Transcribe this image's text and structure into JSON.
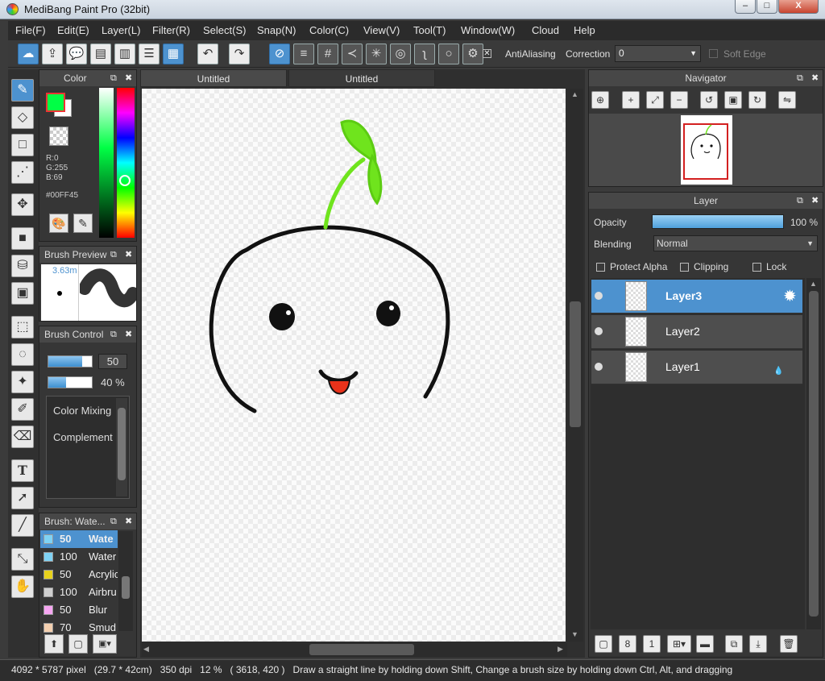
{
  "window": {
    "title": "MediBang Paint Pro (32bit)",
    "minimize": "–",
    "maximize": "□",
    "close": "X"
  },
  "menu": [
    "File(F)",
    "Edit(E)",
    "Layer(L)",
    "Filter(R)",
    "Select(S)",
    "Snap(N)",
    "Color(C)",
    "View(V)",
    "Tool(T)",
    "Window(W)",
    "Cloud",
    "Help"
  ],
  "toolbar": {
    "antialiasing_label": "AntiAliasing",
    "correction_label": "Correction",
    "correction_value": "0",
    "soft_edge_label": "Soft Edge",
    "antialiasing_checked": "✕"
  },
  "color_panel": {
    "title": "Color",
    "r": "R:0",
    "g": "G:255",
    "b": "B:69",
    "hex": "#00FF45",
    "fg": "#00ff45",
    "bg": "#ffffff"
  },
  "brush_preview": {
    "title": "Brush Preview",
    "size": "3.63m"
  },
  "brush_control": {
    "title": "Brush Control",
    "size_value": "50",
    "opacity_value": "40 %",
    "options": [
      "Color Mixing",
      "Complement"
    ]
  },
  "brush_list": {
    "title": "Brush: Wate...",
    "items": [
      {
        "size": "50",
        "name": "Wate",
        "color": "#7fd3f5"
      },
      {
        "size": "100",
        "name": "Water",
        "color": "#7fd3f5"
      },
      {
        "size": "50",
        "name": "Acrylic",
        "color": "#e8d21c"
      },
      {
        "size": "100",
        "name": "Airbru",
        "color": "#cfcfcf"
      },
      {
        "size": "50",
        "name": "Blur",
        "color": "#f6a6f2"
      },
      {
        "size": "70",
        "name": "Smud",
        "color": "#f4d0b0"
      }
    ]
  },
  "tabs": [
    "Untitled",
    "Untitled"
  ],
  "navigator": {
    "title": "Navigator"
  },
  "layer_panel": {
    "title": "Layer",
    "opacity_label": "Opacity",
    "opacity_value": "100 %",
    "opacity_fraction": 1.0,
    "blending_label": "Blending",
    "blending_value": "Normal",
    "protect_alpha": "Protect Alpha",
    "clipping": "Clipping",
    "lock": "Lock"
  },
  "layers": [
    {
      "name": "Layer3",
      "selected": true
    },
    {
      "name": "Layer2",
      "selected": false
    },
    {
      "name": "Layer1",
      "selected": false
    }
  ],
  "status": {
    "text": "4092 * 5787 pixel   (29.7 * 42cm)   350 dpi   12 %   ( 3618, 420 )   Draw a straight line by holding down Shift, Change a brush size by holding down Ctrl, Alt, and dragging"
  },
  "icons": {
    "color_fg": "#00ff45",
    "selection_blue": "#4d92cf"
  }
}
